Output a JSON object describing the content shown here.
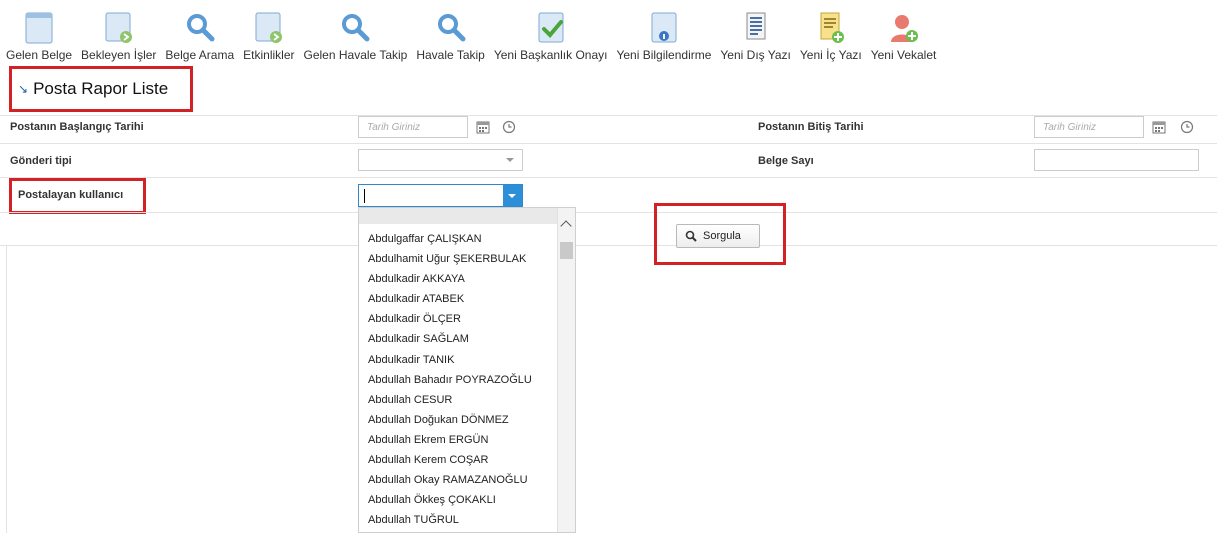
{
  "toolbar": {
    "items": [
      {
        "label": "Gelen Belge",
        "icon": "document-icon"
      },
      {
        "label": "Bekleyen İşler",
        "icon": "document-forward-icon"
      },
      {
        "label": "Belge Arama",
        "icon": "magnifier-icon"
      },
      {
        "label": "Etkinlikler",
        "icon": "document-forward-icon"
      },
      {
        "label": "Gelen Havale Takip",
        "icon": "magnifier-icon"
      },
      {
        "label": "Havale Takip",
        "icon": "magnifier-icon"
      },
      {
        "label": "Yeni Başkanlık Onayı",
        "icon": "document-check-icon"
      },
      {
        "label": "Yeni Bilgilendirme",
        "icon": "document-info-icon"
      },
      {
        "label": "Yeni Dış Yazı",
        "icon": "page-text-icon"
      },
      {
        "label": "Yeni İç Yazı",
        "icon": "page-add-icon"
      },
      {
        "label": "Yeni Vekalet",
        "icon": "user-add-icon"
      }
    ]
  },
  "section": {
    "title": "Posta Rapor Liste"
  },
  "form": {
    "start_date_label": "Postanın Başlangıç Tarihi",
    "start_date_placeholder": "Tarih Giriniz",
    "end_date_label": "Postanın Bitiş Tarihi",
    "end_date_placeholder": "Tarih Giriniz",
    "send_type_label": "Gönderi tipi",
    "doc_number_label": "Belge Sayı",
    "poster_user_label": "Postalayan kullanıcı",
    "query_button": "Sorgula"
  },
  "dropdown": {
    "items": [
      "Abdulgaffar ÇALIŞKAN",
      "Abdulhamit Uğur ŞEKERBULAK",
      "Abdulkadir AKKAYA",
      "Abdulkadir ATABEK",
      "Abdulkadir ÖLÇER",
      "Abdulkadir SAĞLAM",
      "Abdulkadir TANIK",
      "Abdullah Bahadır POYRAZOĞLU",
      "Abdullah CESUR",
      "Abdullah Doğukan DÖNMEZ",
      "Abdullah Ekrem ERGÜN",
      "Abdullah Kerem COŞAR",
      "Abdullah Okay RAMAZANOĞLU",
      "Abdullah Ökkeş ÇOKAKLI",
      "Abdullah TUĞRUL"
    ]
  },
  "colors": {
    "highlight": "#d32226",
    "accent": "#2d8fd8"
  }
}
